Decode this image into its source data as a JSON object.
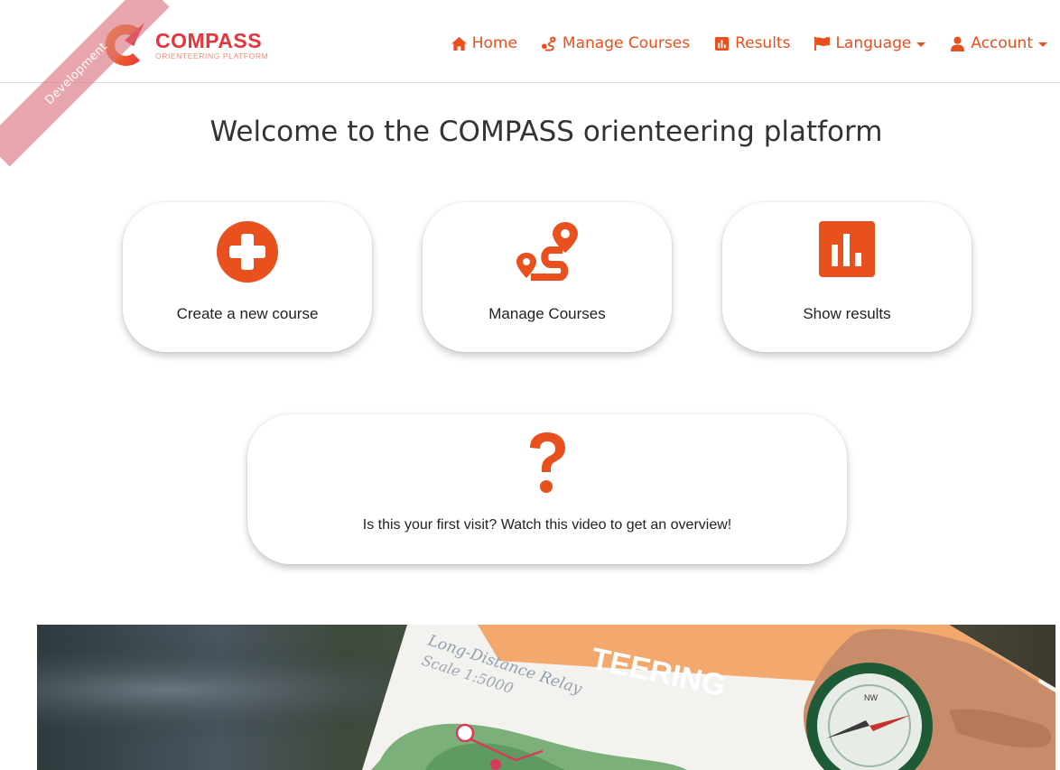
{
  "brand": {
    "name": "COMPASS",
    "subtitle": "ORIENTEERING PLATFORM",
    "ribbon": "Development"
  },
  "nav": {
    "items": [
      {
        "label": "Home",
        "icon": "home-icon"
      },
      {
        "label": "Manage Courses",
        "icon": "route-icon"
      },
      {
        "label": "Results",
        "icon": "bar-chart-icon"
      },
      {
        "label": "Language",
        "icon": "flag-icon",
        "dropdown": true
      },
      {
        "label": "Account",
        "icon": "user-icon",
        "dropdown": true
      }
    ]
  },
  "main": {
    "heading": "Welcome to the COMPASS orienteering platform",
    "cards": [
      {
        "label": "Create a new course",
        "icon": "plus-circle-icon"
      },
      {
        "label": "Manage Courses",
        "icon": "route-icon"
      },
      {
        "label": "Show results",
        "icon": "bar-chart-icon"
      },
      {
        "label": "Is this your first visit? Watch this video to get an overview!",
        "icon": "question-icon"
      }
    ]
  },
  "hero": {
    "map_title": "TEERING",
    "map_subtitle": "Long-Distance Relay",
    "map_scale": "Scale 1:5000",
    "compass_mark": "NW"
  },
  "colors": {
    "accent": "#e8501e",
    "brand_red": "#e8333a",
    "ribbon": "#d86e7d"
  }
}
